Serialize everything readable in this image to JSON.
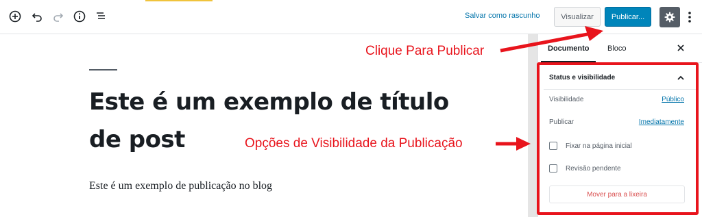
{
  "toolbar": {
    "icons": [
      "add-block-icon",
      "undo-icon",
      "redo-icon",
      "info-icon",
      "block-navigation-icon"
    ],
    "save_draft_label": "Salvar como rascunho",
    "preview_label": "Visualizar",
    "publish_label": "Publicar...",
    "settings_icon": "gear-icon",
    "more_icon": "more-vertical-icon",
    "accent_color": "#0085ba"
  },
  "editor": {
    "post_title": "Este é um exemplo de título de post",
    "post_paragraph": "Este é um exemplo de publicação no blog"
  },
  "sidebar": {
    "tabs": [
      {
        "label": "Documento",
        "active": true
      },
      {
        "label": "Bloco",
        "active": false
      }
    ],
    "close_icon": "close-icon",
    "panel": {
      "title": "Status e visibilidade",
      "toggle_icon": "chevron-up-icon",
      "rows": [
        {
          "label": "Visibilidade",
          "value": "Público"
        },
        {
          "label": "Publicar",
          "value": "Imediatamente"
        }
      ],
      "checkboxes": [
        {
          "label": "Fixar na página inicial",
          "checked": false
        },
        {
          "label": "Revisão pendente",
          "checked": false
        }
      ],
      "trash_label": "Mover para a lixeira"
    }
  },
  "annotations": {
    "publish_callout": "Clique Para Publicar",
    "visibility_callout": "Opções de Visibilidade da Publicação",
    "color": "#e8141c"
  }
}
